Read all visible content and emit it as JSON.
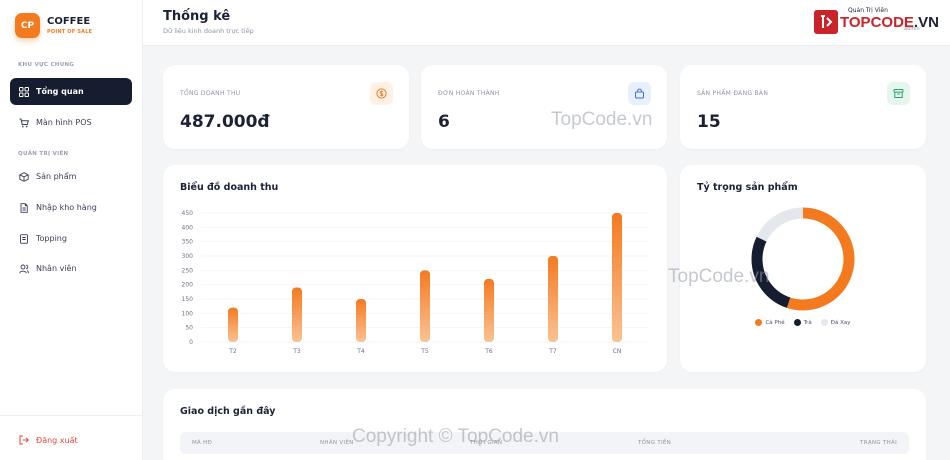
{
  "brand": {
    "logo": "CP",
    "name": "COFFEE",
    "sub": "POINT OF SALE"
  },
  "sidebar": {
    "section_general": "KHU VỰC CHUNG",
    "section_admin": "QUẢN TRỊ VIÊN",
    "items": [
      {
        "label": "Tổng quan",
        "icon": "grid-icon",
        "active": true
      },
      {
        "label": "Màn hình POS",
        "icon": "cart-icon"
      },
      {
        "label": "Sản phẩm",
        "icon": "box-icon"
      },
      {
        "label": "Nhập kho hàng",
        "icon": "file-icon"
      },
      {
        "label": "Topping",
        "icon": "doc-icon"
      },
      {
        "label": "Nhân viên",
        "icon": "users-icon"
      }
    ],
    "logout": "Đăng xuất"
  },
  "header": {
    "title": "Thống kê",
    "subtitle": "Dữ liệu kinh doanh trực tiếp",
    "admin_label": "Quản Trị Viên",
    "admin_sub": "admin",
    "logo_text": "TOPCODE",
    "logo_tld": ".VN"
  },
  "stats": [
    {
      "label": "TỔNG DOANH THU",
      "value": "487.000đ",
      "icon": "dollar-icon",
      "color": "#f47a20"
    },
    {
      "label": "ĐƠN HOÀN THÀNH",
      "value": "6",
      "icon": "bag-icon",
      "color": "#3b6fd8"
    },
    {
      "label": "SẢN PHẨM ĐANG BÁN",
      "value": "15",
      "icon": "archive-icon",
      "color": "#22a66b"
    }
  ],
  "revenue_chart": {
    "title": "Biểu đồ doanh thu"
  },
  "pie_card": {
    "title": "Tỷ trọng sản phẩm"
  },
  "transactions": {
    "title": "Giao dịch gần đây",
    "columns": [
      "MÃ HĐ",
      "NHÂN VIÊN",
      "THỜI GIAN",
      "TỔNG TIỀN",
      "TRẠNG THÁI"
    ]
  },
  "watermarks": [
    "TopCode.vn",
    "TopCode.vn",
    "Copyright © TopCode.vn"
  ],
  "colors": {
    "accent": "#f47a20",
    "dark": "#161d30",
    "light_gray": "#e4e7ec"
  },
  "chart_data": [
    {
      "type": "bar",
      "title": "Biểu đồ doanh thu",
      "categories": [
        "T2",
        "T3",
        "T4",
        "T5",
        "T6",
        "T7",
        "CN"
      ],
      "values": [
        120,
        190,
        150,
        250,
        220,
        300,
        450
      ],
      "yticks": [
        0,
        50,
        100,
        150,
        200,
        250,
        300,
        350,
        400,
        450
      ],
      "ylim": [
        0,
        450
      ],
      "grid": true
    },
    {
      "type": "pie",
      "title": "Tỷ trọng sản phẩm",
      "categories": [
        "Cà Phê",
        "Trà",
        "Đá Xay"
      ],
      "values": [
        55,
        27,
        18
      ],
      "colors": [
        "#f47a20",
        "#161d30",
        "#e4e7ec"
      ],
      "legend": "bottom"
    }
  ]
}
